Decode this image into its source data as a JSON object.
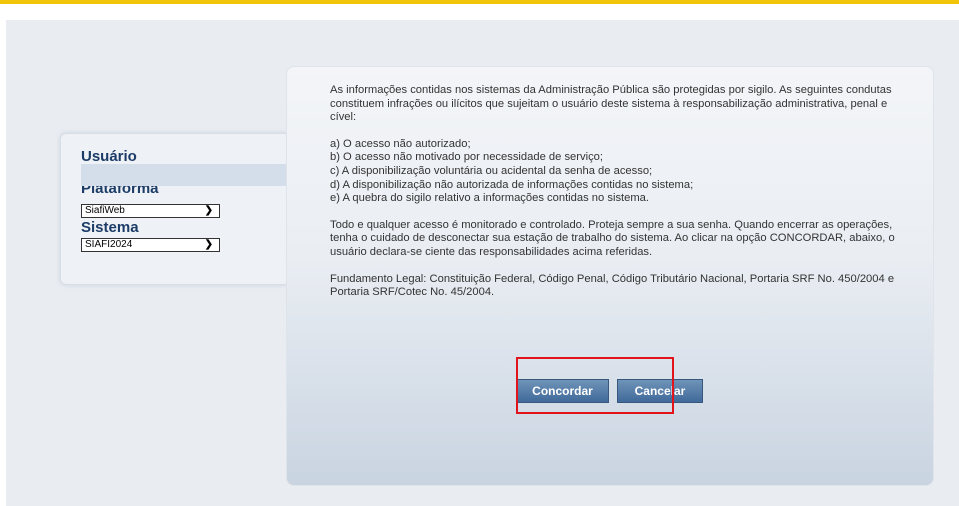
{
  "login": {
    "user_label": "Usuário",
    "platform_label": "Plataforma",
    "platform_value": "SiafiWeb",
    "system_label": "Sistema",
    "system_value": "SIAFI2024"
  },
  "notice": {
    "intro": "As informações contidas nos sistemas da Administração Pública são protegidas por sigilo. As seguintes condutas constituem infrações ou ilícitos que sujeitam o usuário deste sistema à responsabilização administrativa, penal e cível:",
    "items": [
      "a) O acesso não autorizado;",
      "b) O acesso não motivado por necessidade de serviço;",
      "c) A disponibilização voluntária ou acidental da senha de acesso;",
      "d) A disponibilização não autorizada de informações contidas no sistema;",
      "e) A quebra do sigilo relativo a informações contidas no sistema."
    ],
    "monitoring": "Todo e qualquer acesso é monitorado e controlado. Proteja sempre a sua senha. Quando encerrar as operações, tenha o cuidado de desconectar sua estação de trabalho do sistema. Ao clicar na opção CONCORDAR, abaixo, o usuário declara-se ciente das responsabilidades acima referidas.",
    "legal": "Fundamento Legal: Constituição Federal, Código Penal, Código Tributário Nacional, Portaria SRF No. 450/2004 e Portaria SRF/Cotec No. 45/2004."
  },
  "buttons": {
    "agree": "Concordar",
    "cancel": "Cancelar"
  },
  "colors": {
    "accent_bar": "#f2c40a",
    "button": "#41699a",
    "highlight": "#e0141a"
  }
}
